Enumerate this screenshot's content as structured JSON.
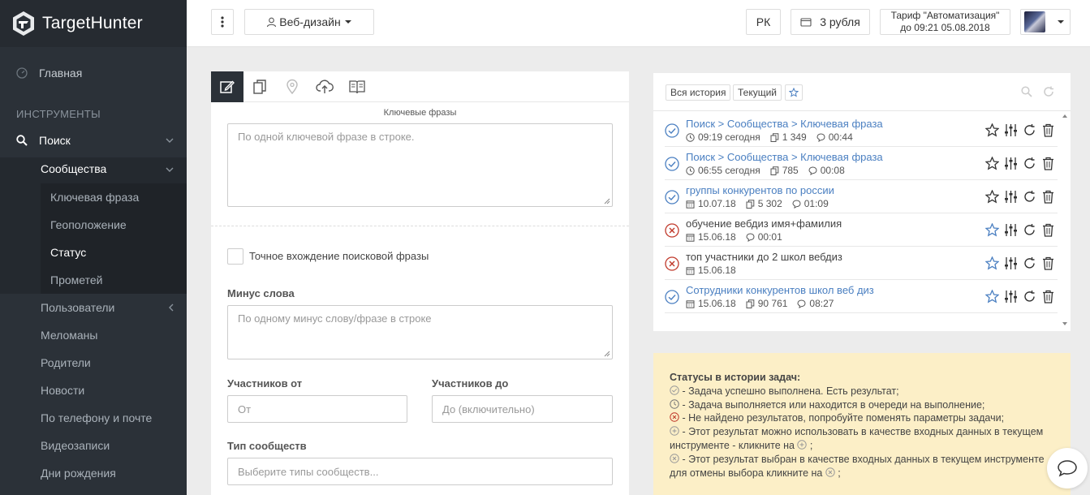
{
  "brand": {
    "name": "TargetHunter"
  },
  "sidebar": {
    "home": "Главная",
    "section": "ИНСТРУМЕНТЫ",
    "search": "Поиск",
    "communities": "Сообщества",
    "community_items": [
      "Ключевая фраза",
      "Геоположение",
      "Статус",
      "Прометей"
    ],
    "active_item": "Статус",
    "other_items": [
      "Пользователи",
      "Меломаны",
      "Родители",
      "Новости",
      "По телефону и почте",
      "Видеозаписи",
      "Дни рождения"
    ]
  },
  "topbar": {
    "menu_icon": "vertical-dots-icon",
    "project": "Веб-дизайн",
    "rk": "РК",
    "balance": "3 рубля",
    "tariff_line1": "Тариф \"Автоматизация\"",
    "tariff_line2": "до 09:21 05.08.2018"
  },
  "form": {
    "tabs": [
      "edit-icon",
      "copy-icon",
      "location-icon",
      "cloud-upload-icon",
      "book-icon"
    ],
    "keywords_caption": "Ключевые фразы",
    "keywords_placeholder": "По одной ключевой фразе в строке.",
    "exact_match": "Точное вхождение поисковой фразы",
    "minus_label": "Минус слова",
    "minus_placeholder": "По одному минус слову/фразе в строке",
    "members_from_label": "Участников от",
    "members_from_placeholder": "От",
    "members_to_label": "Участников до",
    "members_to_placeholder": "До (включительно)",
    "type_label": "Тип сообществ",
    "type_placeholder": "Выберите типы сообществ..."
  },
  "history": {
    "tab_all": "Вся история",
    "tab_current": "Текущий",
    "rows": [
      {
        "status": "done",
        "title": "Поиск > Сообщества > Ключевая фраза",
        "link": true,
        "date_icon": "clock",
        "date": "09:19 сегодня",
        "count": "1 349",
        "duration": "00:44",
        "starred": false
      },
      {
        "status": "done",
        "title": "Поиск > Сообщества > Ключевая фраза",
        "link": true,
        "date_icon": "clock",
        "date": "06:55 сегодня",
        "count": "785",
        "duration": "00:08",
        "starred": false
      },
      {
        "status": "done",
        "title": "группы конкурентов по россии",
        "link": true,
        "date_icon": "calendar",
        "date": "10.07.18",
        "count": "5 302",
        "duration": "01:09",
        "starred": false
      },
      {
        "status": "fail",
        "title": "обучение вебдиз имя+фамилия",
        "link": false,
        "date_icon": "calendar",
        "date": "15.06.18",
        "count": "",
        "duration": "00:01",
        "starred": true
      },
      {
        "status": "fail",
        "title": "топ участники до 2 школ вебдиз",
        "link": false,
        "date_icon": "calendar",
        "date": "15.06.18",
        "count": "",
        "duration": "",
        "starred": true
      },
      {
        "status": "done",
        "title": "Сотрудники конкурентов школ веб диз",
        "link": true,
        "date_icon": "calendar",
        "date": "15.06.18",
        "count": "90 761",
        "duration": "08:27",
        "starred": true
      }
    ]
  },
  "legend": {
    "title": "Статусы в истории задач:",
    "l1": " - Задача успешно выполнена. Есть результат;",
    "l2": " - Задача выполняется или находится в очереди на выполнение;",
    "l3": " - Не найдено результатов, попробуйте поменять параметры задачи;",
    "l4a": " - Этот результат можно использовать в качестве входных данных в текущем",
    "l4b": "инструменте - кликните на ",
    "l5a": " - Этот результат выбран в качестве входных данных в текущем инструменте",
    "l5b": "для отмены выбора кликните на "
  },
  "colors": {
    "accent": "#4a7fc1",
    "success": "#4a7fc1",
    "danger": "#c0392b",
    "sidebar": "#2b3138",
    "legend_bg": "#fcefc7"
  }
}
